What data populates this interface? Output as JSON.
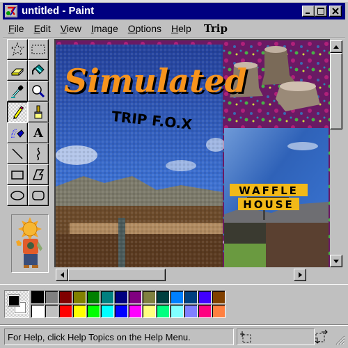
{
  "window": {
    "title": "untitled - Paint",
    "controls": {
      "minimize": "minimize",
      "maximize": "maximize",
      "close": "close"
    }
  },
  "menu": {
    "items": [
      {
        "label": "File",
        "accel": "F",
        "rest": "ile"
      },
      {
        "label": "Edit",
        "accel": "E",
        "rest": "dit"
      },
      {
        "label": "View",
        "accel": "V",
        "rest": "iew"
      },
      {
        "label": "Image",
        "accel": "I",
        "rest": "mage"
      },
      {
        "label": "Options",
        "accel": "O",
        "rest": "ptions"
      },
      {
        "label": "Help",
        "accel": "H",
        "rest": "elp"
      }
    ],
    "extra": "Trip"
  },
  "tools": [
    {
      "name": "free-form-select",
      "icon": "star-select-icon"
    },
    {
      "name": "select",
      "icon": "rect-select-icon"
    },
    {
      "name": "eraser",
      "icon": "eraser-icon"
    },
    {
      "name": "fill-with-color",
      "icon": "paint-bucket-icon"
    },
    {
      "name": "pick-color",
      "icon": "eyedropper-icon"
    },
    {
      "name": "magnifier",
      "icon": "magnifier-icon"
    },
    {
      "name": "pencil",
      "icon": "pencil-icon",
      "active": true
    },
    {
      "name": "brush",
      "icon": "brush-icon"
    },
    {
      "name": "airbrush",
      "icon": "airbrush-icon"
    },
    {
      "name": "text",
      "icon": "text-icon",
      "glyph": "A"
    },
    {
      "name": "line",
      "icon": "line-icon"
    },
    {
      "name": "curve",
      "icon": "curve-icon"
    },
    {
      "name": "rectangle",
      "icon": "rectangle-icon"
    },
    {
      "name": "polygon",
      "icon": "polygon-icon"
    },
    {
      "name": "ellipse",
      "icon": "ellipse-icon"
    },
    {
      "name": "rounded-rectangle",
      "icon": "rounded-rectangle-icon"
    }
  ],
  "tool_options": {
    "content": "sun-head-character-sticker"
  },
  "canvas": {
    "title_art": "Simulated",
    "subtitle_art": "TRIP F.O.X",
    "sign_line1": "WAFFLE",
    "sign_line2": "HOUSE",
    "colors": {
      "title_orange": "#f7941d",
      "sky_blue": "#2d5fb8",
      "psychedelic_bg": "#7a1e6a",
      "sign_yellow": "#f2b918"
    }
  },
  "palette": {
    "foreground": "#000000",
    "background": "#ffffff",
    "row1": [
      "#000000",
      "#808080",
      "#800000",
      "#808000",
      "#008000",
      "#008080",
      "#000080",
      "#800080",
      "#808040",
      "#004040",
      "#0080ff",
      "#004080",
      "#4000ff",
      "#804000"
    ],
    "row2": [
      "#ffffff",
      "#c0c0c0",
      "#ff0000",
      "#ffff00",
      "#00ff00",
      "#00ffff",
      "#0000ff",
      "#ff00ff",
      "#ffff80",
      "#00ff80",
      "#80ffff",
      "#8080ff",
      "#ff0080",
      "#ff8040"
    ]
  },
  "status": {
    "help_text": "For Help, click Help Topics on the Help Menu.",
    "position": "",
    "size": ""
  }
}
